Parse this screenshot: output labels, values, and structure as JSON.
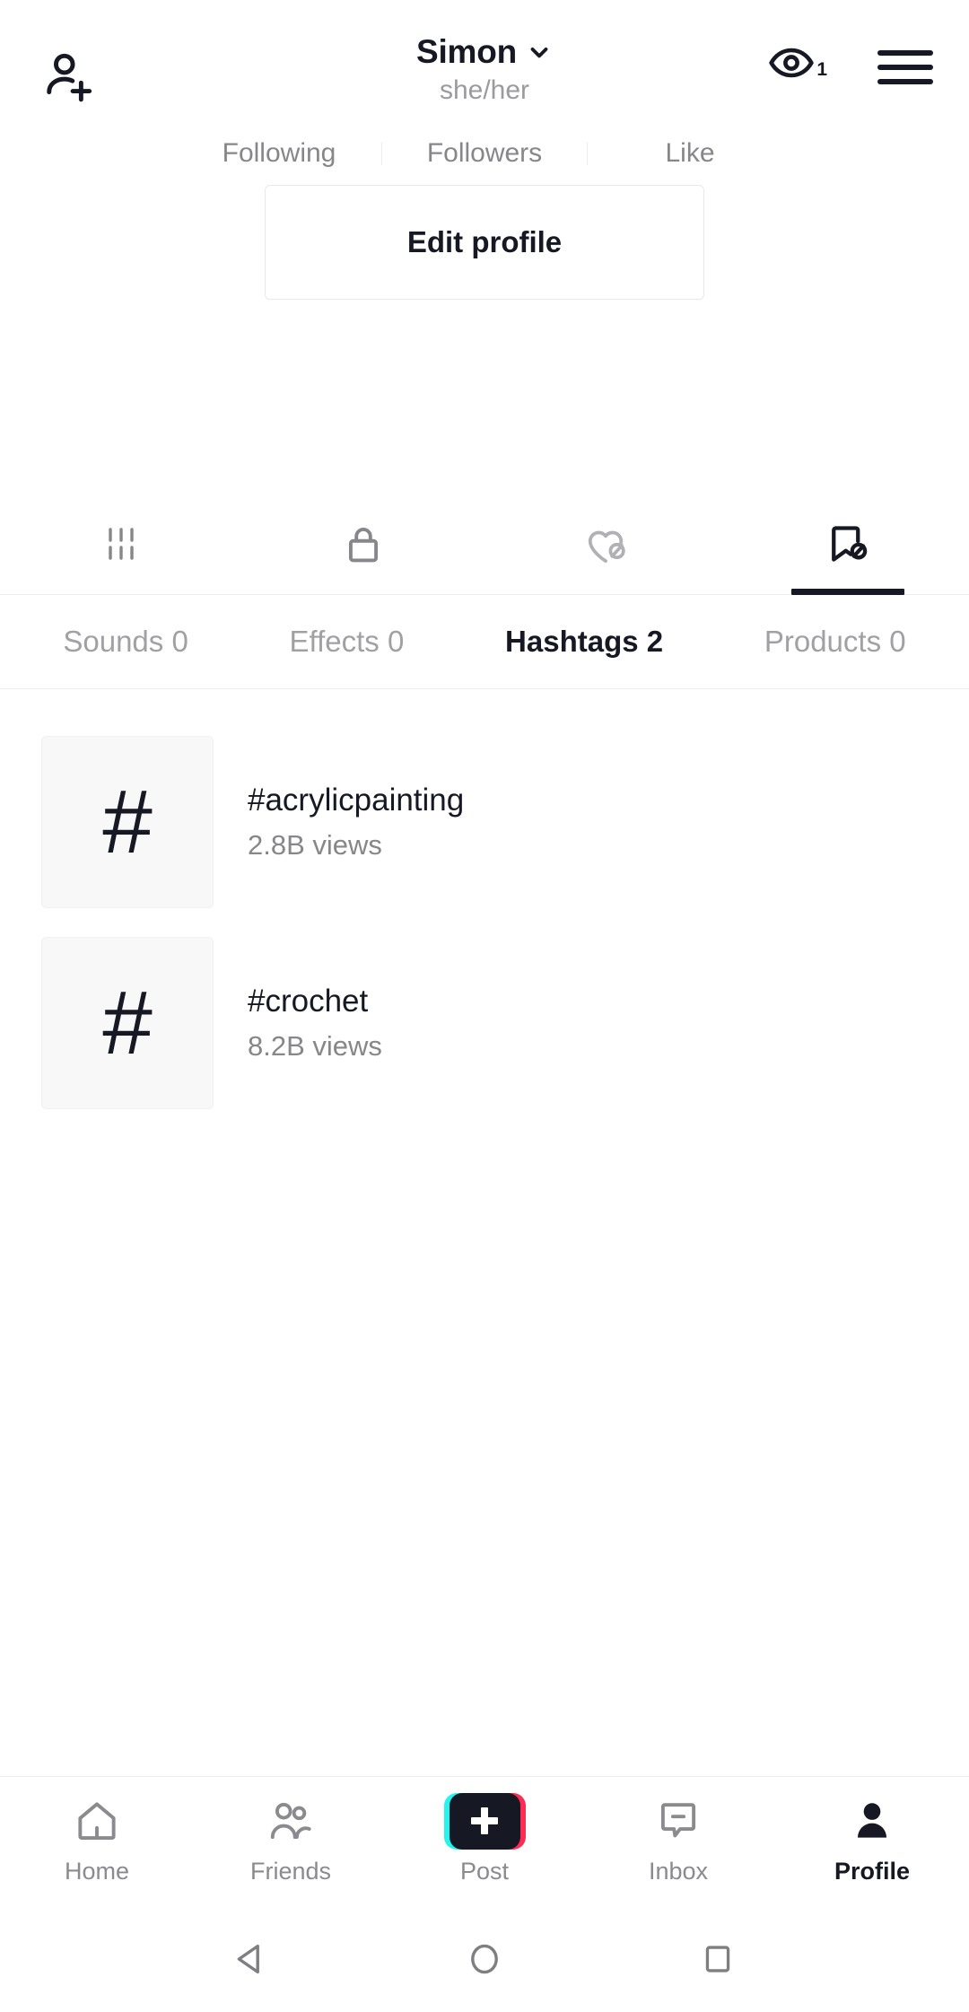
{
  "header": {
    "add_person_icon": "add-person-icon",
    "username": "Simon",
    "chevron_icon": "chevron-down-icon",
    "pronouns": "she/her",
    "views_icon": "eye-icon",
    "views_count": "1",
    "menu_icon": "hamburger-menu-icon"
  },
  "stats": [
    {
      "label": "Following"
    },
    {
      "label": "Followers"
    },
    {
      "label": "Like"
    }
  ],
  "actions": {
    "edit_profile_label": "Edit profile"
  },
  "icon_tabs": [
    {
      "name": "posts-tab",
      "icon": "grid-bars-icon",
      "active": false
    },
    {
      "name": "private-tab",
      "icon": "lock-icon",
      "active": false
    },
    {
      "name": "liked-tab",
      "icon": "heart-slash-icon",
      "active": false
    },
    {
      "name": "saved-tab",
      "icon": "bookmark-slash-icon",
      "active": true
    }
  ],
  "sub_tabs": [
    {
      "label": "Sounds 0",
      "active": false
    },
    {
      "label": "Effects 0",
      "active": false
    },
    {
      "label": "Hashtags 2",
      "active": true
    },
    {
      "label": "Products 0",
      "active": false
    }
  ],
  "hashtags": [
    {
      "thumb": "#",
      "title": "#acrylicpainting",
      "views": "2.8B views"
    },
    {
      "thumb": "#",
      "title": "#crochet",
      "views": "8.2B views"
    }
  ],
  "bottom_nav": [
    {
      "label": "Home",
      "icon": "home-icon",
      "active": false
    },
    {
      "label": "Friends",
      "icon": "friends-icon",
      "active": false
    },
    {
      "label": "Post",
      "icon": "plus-icon",
      "active": false
    },
    {
      "label": "Inbox",
      "icon": "inbox-icon",
      "active": false
    },
    {
      "label": "Profile",
      "icon": "person-icon",
      "active": true
    }
  ],
  "system_nav": [
    {
      "name": "back-button",
      "icon": "triangle-back-icon"
    },
    {
      "name": "home-button",
      "icon": "circle-home-icon"
    },
    {
      "name": "recents-button",
      "icon": "square-recents-icon"
    }
  ],
  "colors": {
    "text_primary": "#161823",
    "text_secondary": "#86868b",
    "accent_cyan": "#25F4EE",
    "accent_pink": "#FE2C55",
    "border": "#EDEDEE"
  }
}
